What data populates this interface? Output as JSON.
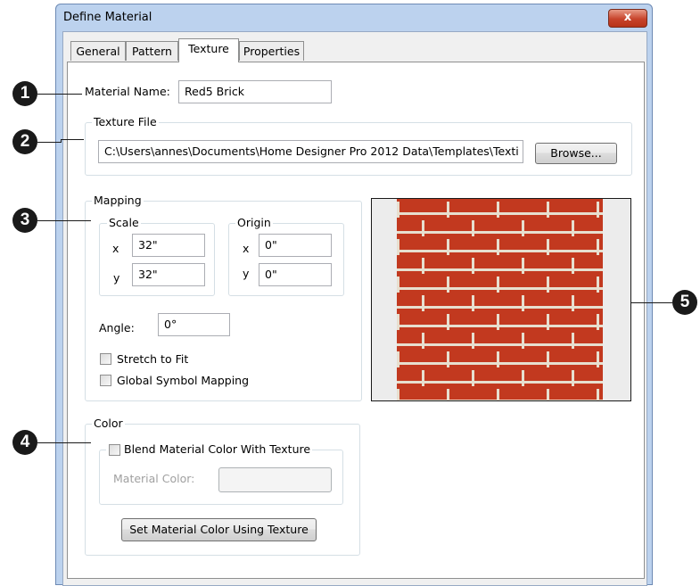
{
  "window": {
    "title": "Define Material",
    "close_label": "x"
  },
  "tabs": [
    {
      "label": "General",
      "active": false
    },
    {
      "label": "Pattern",
      "active": false
    },
    {
      "label": "Texture",
      "active": true
    },
    {
      "label": "Properties",
      "active": false
    }
  ],
  "material_name": {
    "label": "Material Name:",
    "value": "Red5 Brick"
  },
  "texture_file": {
    "group_label": "Texture File",
    "path": "C:\\Users\\annes\\Documents\\Home Designer Pro 2012 Data\\Templates\\Texti",
    "browse_label": "Browse..."
  },
  "mapping": {
    "group_label": "Mapping",
    "scale": {
      "label": "Scale",
      "x_label": "x",
      "x_value": "32\"",
      "y_label": "y",
      "y_value": "32\""
    },
    "origin": {
      "label": "Origin",
      "x_label": "x",
      "x_value": "0\"",
      "y_label": "y",
      "y_value": "0\""
    },
    "angle": {
      "label": "Angle:",
      "value": "0°"
    },
    "stretch_to_fit": {
      "label": "Stretch to Fit",
      "checked": false
    },
    "global_symbol_mapping": {
      "label": "Global Symbol Mapping",
      "checked": false
    }
  },
  "color": {
    "group_label": "Color",
    "blend": {
      "label": "Blend Material Color With Texture",
      "checked": false
    },
    "material_color_label": "Material Color:",
    "set_button_label": "Set Material Color Using Texture"
  },
  "callouts": [
    "1",
    "2",
    "3",
    "4",
    "5"
  ],
  "colors": {
    "brick": "#c2391f",
    "mortar": "#e7dfcf",
    "titlebar": "#bcd2ee",
    "callout": "#1a1a1a"
  }
}
